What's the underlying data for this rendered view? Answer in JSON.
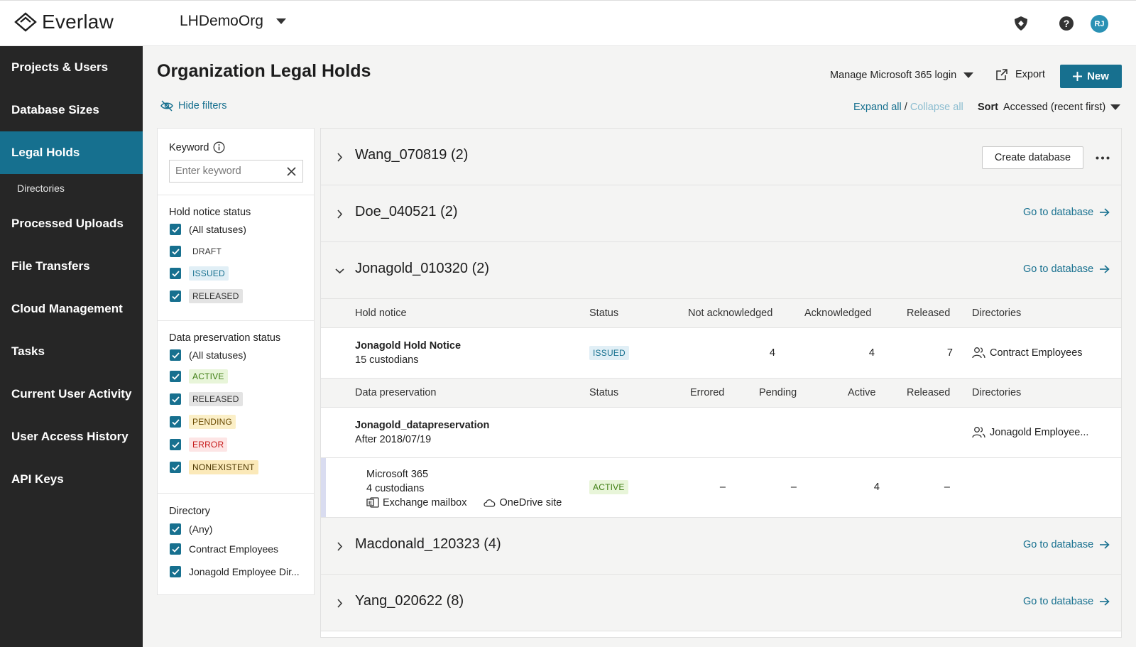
{
  "app": {
    "logo": "Everlaw",
    "org": "LHDemoOrg",
    "avatar": "RJ"
  },
  "sidebar": {
    "items": [
      {
        "label": "Projects & Users"
      },
      {
        "label": "Database Sizes"
      },
      {
        "label": "Legal Holds",
        "active": true
      },
      {
        "label": "Directories",
        "sub": true
      },
      {
        "label": "Processed Uploads"
      },
      {
        "label": "File Transfers"
      },
      {
        "label": "Cloud Management"
      },
      {
        "label": "Tasks"
      },
      {
        "label": "Current User Activity"
      },
      {
        "label": "User Access History"
      },
      {
        "label": "API Keys"
      }
    ]
  },
  "header": {
    "title": "Organization Legal Holds",
    "hide_filters": "Hide filters",
    "manage_ms": "Manage Microsoft 365 login",
    "export": "Export",
    "new": "New",
    "expand_all": "Expand all",
    "separator": "/",
    "collapse_all": "Collapse all",
    "sort_label": "Sort",
    "sort_value": "Accessed (recent first)"
  },
  "filters": {
    "keyword_label": "Keyword",
    "keyword_placeholder": "Enter keyword",
    "hold_notice_status": {
      "title": "Hold notice status",
      "options": [
        "(All statuses)",
        "DRAFT",
        "ISSUED",
        "RELEASED"
      ]
    },
    "data_preservation_status": {
      "title": "Data preservation status",
      "options": [
        "(All statuses)",
        "ACTIVE",
        "RELEASED",
        "PENDING",
        "ERROR",
        "NONEXISTENT"
      ]
    },
    "directory": {
      "title": "Directory",
      "options": [
        "(Any)",
        "Contract Employees",
        "Jonagold Employee Dir..."
      ]
    }
  },
  "matters": [
    {
      "name": "Wang_070819",
      "count": "(2)",
      "create_db": "Create database"
    },
    {
      "name": "Doe_040521",
      "count": "(2)",
      "goto": "Go to database"
    },
    {
      "name": "Jonagold_010320",
      "count": "(2)",
      "goto": "Go to database"
    },
    {
      "name": "Macdonald_120323",
      "count": "(4)",
      "goto": "Go to database"
    },
    {
      "name": "Yang_020622",
      "count": "(8)",
      "goto": "Go to database"
    }
  ],
  "hold_table": {
    "headers": [
      "Hold notice",
      "Status",
      "Not acknowledged",
      "Acknowledged",
      "Released",
      "Directories"
    ],
    "row": {
      "name": "Jonagold Hold Notice",
      "sub": "15 custodians",
      "status": "ISSUED",
      "not_ack": "4",
      "ack": "4",
      "released": "7",
      "directory": "Contract Employees"
    }
  },
  "preservation_table": {
    "headers": [
      "Data preservation",
      "Status",
      "Errored",
      "Pending",
      "Active",
      "Released",
      "Directories"
    ],
    "row": {
      "name": "Jonagold_datapreservation",
      "sub": "After 2018/07/19",
      "directory": "Jonagold Employee..."
    },
    "source": {
      "name": "Microsoft 365",
      "custodians": "4 custodians",
      "src1": "Exchange mailbox",
      "src2": "OneDrive site",
      "status": "ACTIVE",
      "errored": "–",
      "pending": "–",
      "active": "4",
      "released": "–"
    }
  }
}
